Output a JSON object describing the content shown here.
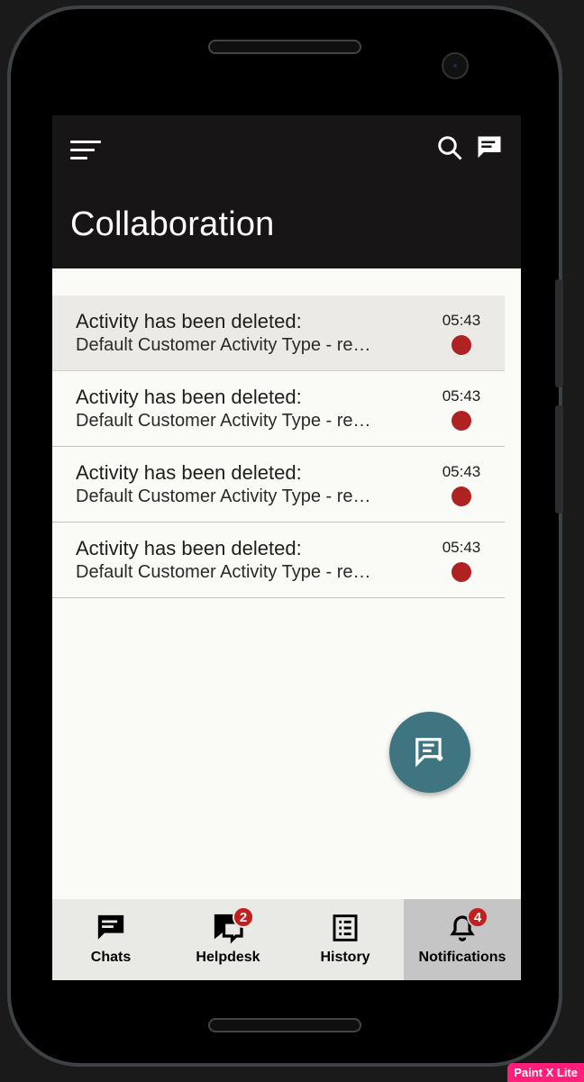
{
  "header": {
    "title": "Collaboration"
  },
  "notifications": [
    {
      "title": "Activity has been deleted:",
      "subtitle": "Default Customer Activity Type - re…",
      "time": "05:43",
      "unread": true,
      "highlight": true
    },
    {
      "title": "Activity has been deleted:",
      "subtitle": "Default Customer Activity Type - re…",
      "time": "05:43",
      "unread": true,
      "highlight": false
    },
    {
      "title": "Activity has been deleted:",
      "subtitle": "Default Customer Activity Type - re…",
      "time": "05:43",
      "unread": true,
      "highlight": false
    },
    {
      "title": "Activity has been deleted:",
      "subtitle": "Default Customer Activity Type - re…",
      "time": "05:43",
      "unread": true,
      "highlight": false
    }
  ],
  "bottom_nav": {
    "chats": {
      "label": "Chats",
      "badge": null,
      "active": false
    },
    "helpdesk": {
      "label": "Helpdesk",
      "badge": "2",
      "active": false
    },
    "history": {
      "label": "History",
      "badge": null,
      "active": false
    },
    "notifications": {
      "label": "Notifications",
      "badge": "4",
      "active": true
    }
  },
  "watermark": "Paint X Lite"
}
